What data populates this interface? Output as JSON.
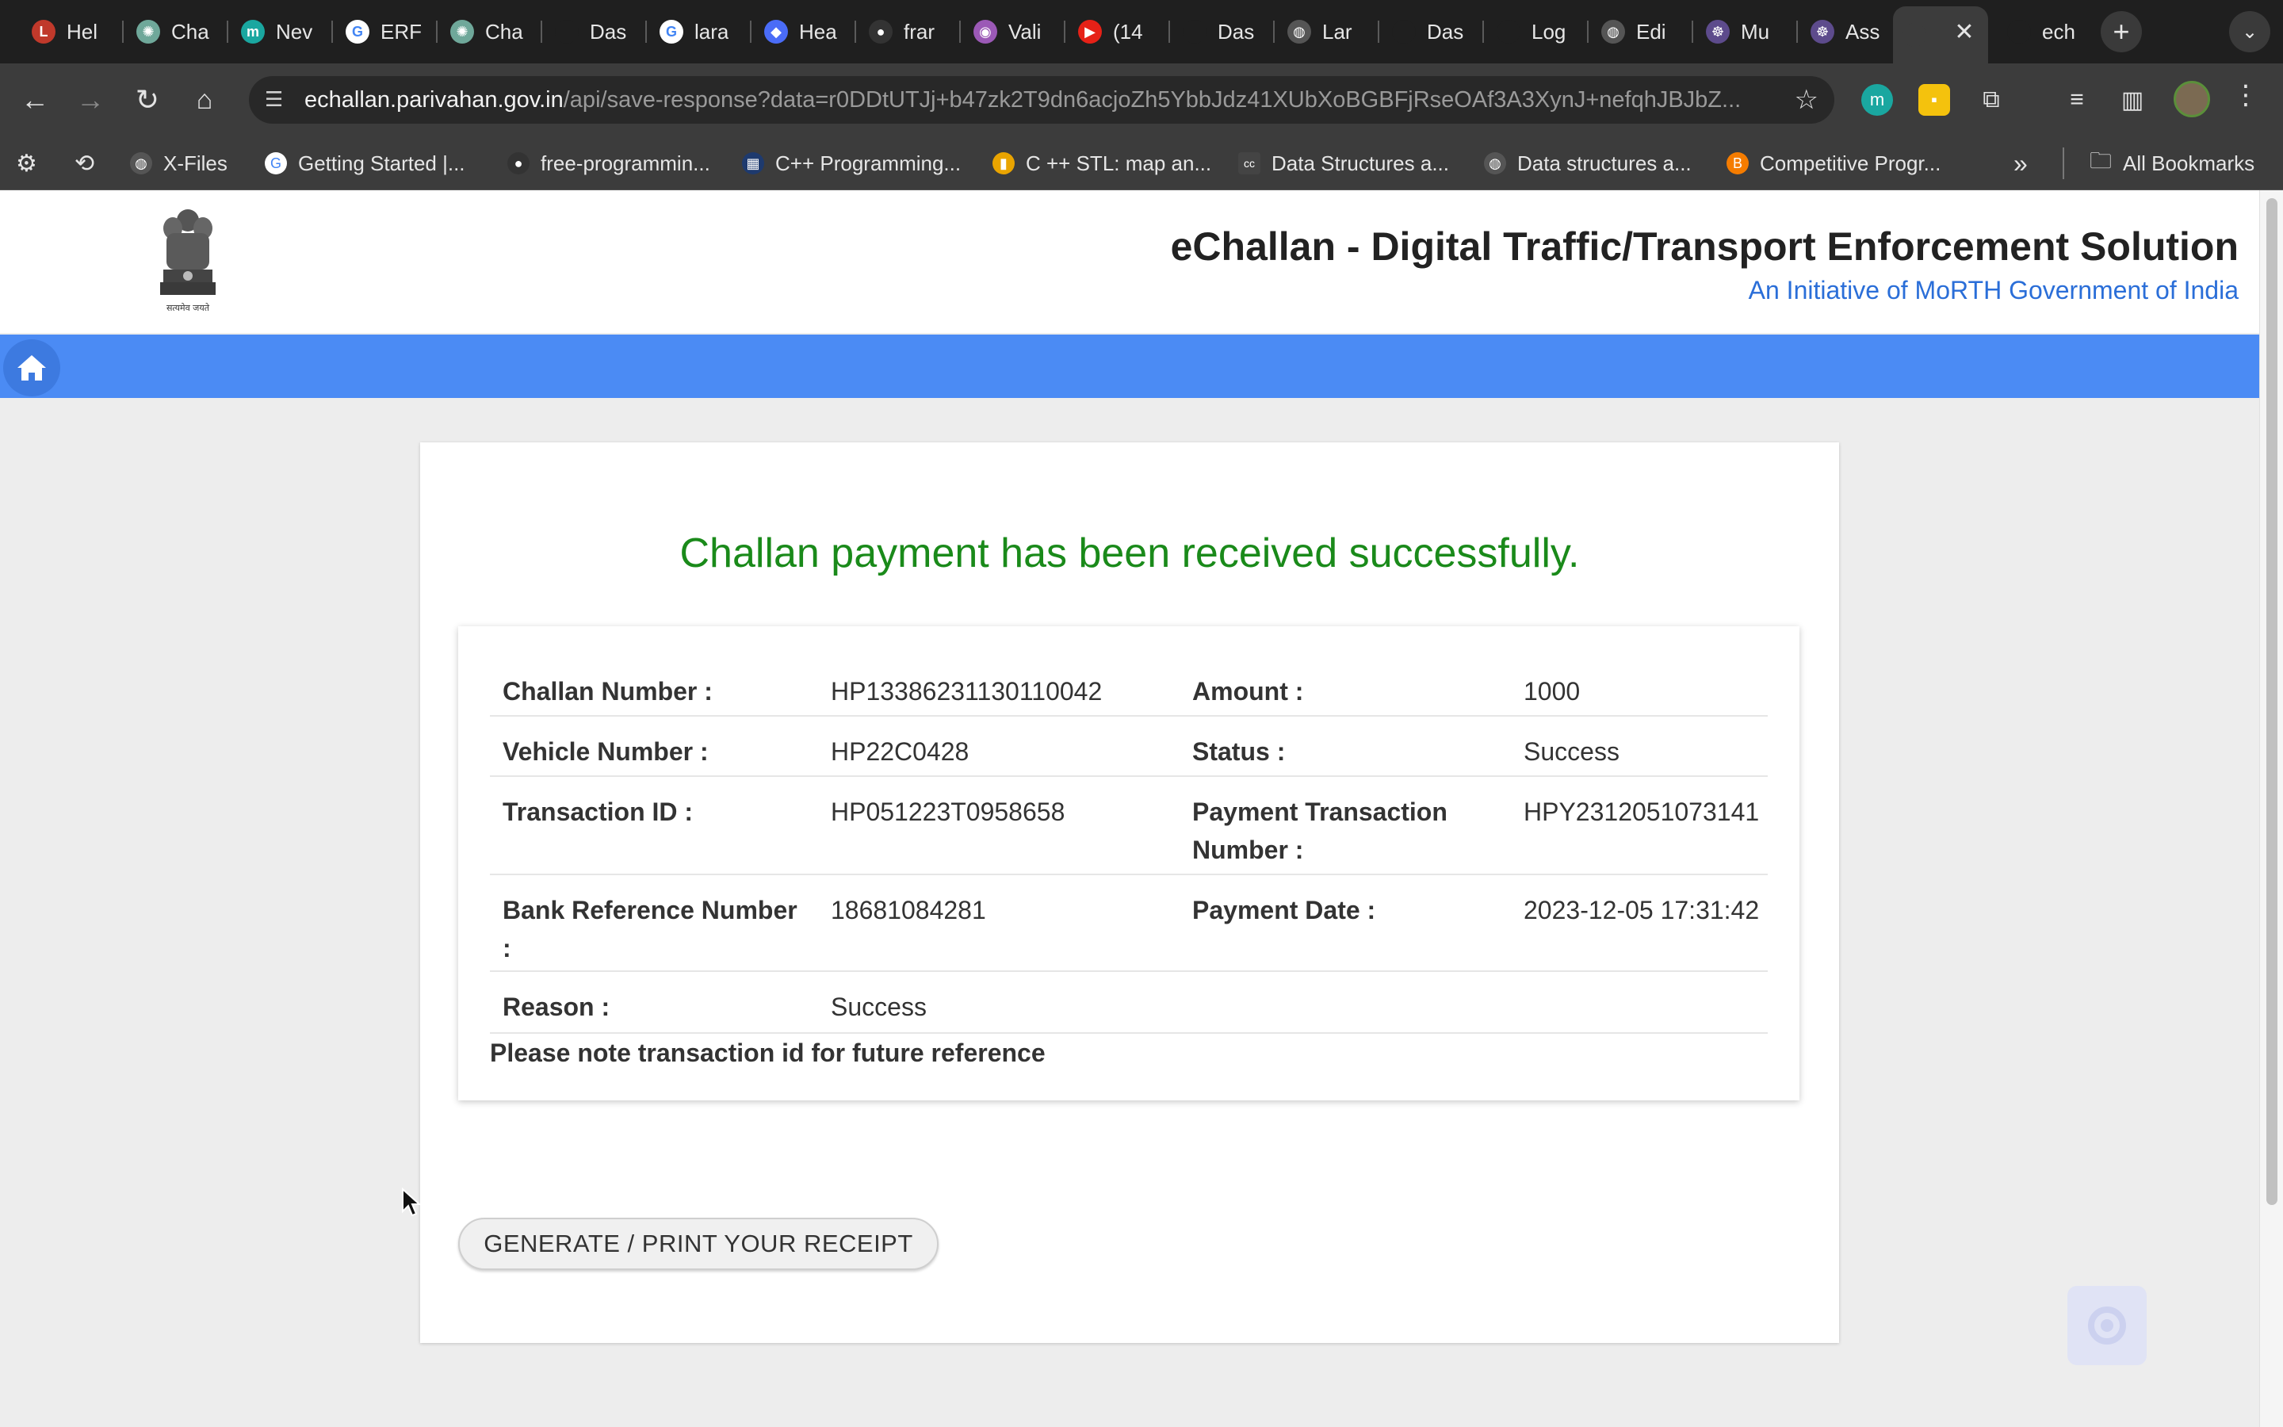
{
  "browser": {
    "tabs": [
      {
        "title": "Hel",
        "color": "#c0392b",
        "glyph": "L"
      },
      {
        "title": "Cha",
        "color": "#6fa89a",
        "glyph": "✺"
      },
      {
        "title": "Nev",
        "color": "#1aa7a0",
        "glyph": "m"
      },
      {
        "title": "ERF",
        "color": "#ffffff",
        "glyph": "G"
      },
      {
        "title": "Cha",
        "color": "#6fa89a",
        "glyph": "✺"
      },
      {
        "title": "Das",
        "color": "#1f1f1f",
        "glyph": ""
      },
      {
        "title": "lara",
        "color": "#ffffff",
        "glyph": "G"
      },
      {
        "title": "Hea",
        "color": "#4a6cf7",
        "glyph": "◆"
      },
      {
        "title": "frar",
        "color": "#333333",
        "glyph": "●"
      },
      {
        "title": "Vali",
        "color": "#9b59b6",
        "glyph": "◉"
      },
      {
        "title": "(14",
        "color": "#e62117",
        "glyph": "▶"
      },
      {
        "title": "Das",
        "color": "#1f1f1f",
        "glyph": ""
      },
      {
        "title": "Lar",
        "color": "#555555",
        "glyph": "◍"
      },
      {
        "title": "Das",
        "color": "#1f1f1f",
        "glyph": ""
      },
      {
        "title": "Log",
        "color": "#1f1f1f",
        "glyph": ""
      },
      {
        "title": "Edi",
        "color": "#555555",
        "glyph": "◍"
      },
      {
        "title": "Mu",
        "color": "#5d4b8c",
        "glyph": "☸"
      },
      {
        "title": "Ass",
        "color": "#5d4b8c",
        "glyph": "☸"
      },
      {
        "title": "",
        "color": "#3c3c3c",
        "glyph": ""
      },
      {
        "title": "ech",
        "color": "#1f1f1f",
        "glyph": ""
      }
    ],
    "url_host": "echallan.parivahan.gov.in",
    "url_path": "/api/save-response?data=r0DDtUTJj+b47zk2T9dn6acjoZh5YbbJdz41XUbXoBGBFjRseOAf3A3XynJ+nefqhJBJbZ...",
    "bookmarks": [
      {
        "label": "X-Files",
        "color": "#555555",
        "glyph": "◍"
      },
      {
        "label": "Getting Started  |...",
        "color": "#ffffff",
        "glyph": "G"
      },
      {
        "label": "free-programmin...",
        "color": "#333333",
        "glyph": "●"
      },
      {
        "label": "C++ Programming...",
        "color": "#1e3a6e",
        "glyph": "▦"
      },
      {
        "label": "C ++ STL: map an...",
        "color": "#e9a400",
        "glyph": "▮"
      },
      {
        "label": "Data Structures a...",
        "color": "#444444",
        "glyph": "cc"
      },
      {
        "label": "Data structures a...",
        "color": "#555555",
        "glyph": "◍"
      },
      {
        "label": "Competitive Progr...",
        "color": "#f57c00",
        "glyph": "B"
      }
    ],
    "all_bookmarks_label": "All Bookmarks"
  },
  "site": {
    "title": "eChallan - Digital Traffic/Transport Enforcement Solution",
    "subtitle": "An Initiative of MoRTH Government of India",
    "emblem_motto": "सत्यमेव जयते"
  },
  "payment": {
    "success_message": "Challan payment has been received successfully.",
    "rows": [
      {
        "l1": "Challan Number :",
        "v1": "HP13386231130110042",
        "l2": "Amount :",
        "v2": "1000"
      },
      {
        "l1": "Vehicle Number :",
        "v1": "HP22C0428",
        "l2": "Status :",
        "v2": "Success"
      },
      {
        "l1": "Transaction ID :",
        "v1": "HP051223T0958658",
        "l2": "Payment Transaction Number :",
        "v2": "HPY2312051073141"
      },
      {
        "l1": "Bank Reference Number :",
        "v1": "18681084281",
        "l2": "Payment Date :",
        "v2": "2023-12-05 17:31:42"
      },
      {
        "l1": "Reason :",
        "v1": "Success",
        "l2": "",
        "v2": ""
      }
    ],
    "note": "Please note transaction id for future reference",
    "receipt_button": "GENERATE / PRINT YOUR RECEIPT"
  },
  "colors": {
    "navbar": "#4b8bf4",
    "success": "#1a8a1a",
    "subtitle": "#2a6ed8"
  }
}
